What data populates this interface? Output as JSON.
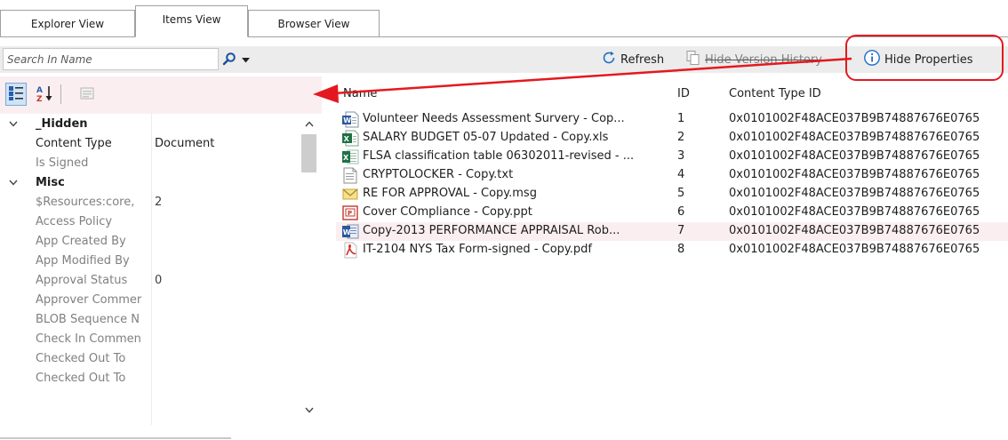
{
  "tabs": [
    {
      "label": "Explorer View",
      "active": false
    },
    {
      "label": "Items View",
      "active": true
    },
    {
      "label": "Browser View",
      "active": false
    }
  ],
  "toolbar": {
    "search_placeholder": "Search In Name",
    "refresh_label": "Refresh",
    "hide_version_history_label": "Hide Version History",
    "hide_properties_label": "Hide Properties"
  },
  "properties": {
    "rows": [
      {
        "type": "category",
        "name": "_Hidden",
        "expanded": true
      },
      {
        "type": "item",
        "name": "Content Type",
        "value": "Document",
        "emphasis": true
      },
      {
        "type": "item",
        "name": "Is Signed",
        "value": ""
      },
      {
        "type": "category",
        "name": "Misc",
        "expanded": true
      },
      {
        "type": "item",
        "name": "$Resources:core,",
        "value": "2"
      },
      {
        "type": "item",
        "name": "Access Policy",
        "value": ""
      },
      {
        "type": "item",
        "name": "App Created By",
        "value": ""
      },
      {
        "type": "item",
        "name": "App Modified By",
        "value": ""
      },
      {
        "type": "item",
        "name": "Approval Status",
        "value": "0"
      },
      {
        "type": "item",
        "name": "Approver Commer",
        "value": ""
      },
      {
        "type": "item",
        "name": "BLOB Sequence N",
        "value": ""
      },
      {
        "type": "item",
        "name": "Check In Commen",
        "value": ""
      },
      {
        "type": "item",
        "name": "Checked Out To",
        "value": ""
      },
      {
        "type": "item",
        "name": "Checked Out To",
        "value": ""
      }
    ]
  },
  "list": {
    "columns": {
      "name": "Name",
      "id": "ID",
      "content_type_id": "Content Type ID"
    },
    "rows": [
      {
        "icon": "word-doc-icon",
        "name": "Volunteer Needs Assessment Survery - Cop...",
        "id": "1",
        "content_type_id": "0x0101002F48ACE037B9B74887676E0765",
        "selected": false
      },
      {
        "icon": "excel-icon",
        "name": "SALARY BUDGET 05-07 Updated - Copy.xls",
        "id": "2",
        "content_type_id": "0x0101002F48ACE037B9B74887676E0765",
        "selected": false
      },
      {
        "icon": "excel-icon",
        "name": "FLSA classification table 06302011-revised - ...",
        "id": "3",
        "content_type_id": "0x0101002F48ACE037B9B74887676E0765",
        "selected": false
      },
      {
        "icon": "text-file-icon",
        "name": "CRYPTOLOCKER - Copy.txt",
        "id": "4",
        "content_type_id": "0x0101002F48ACE037B9B74887676E0765",
        "selected": false
      },
      {
        "icon": "email-icon",
        "name": "RE  FOR APPROVAL  - Copy.msg",
        "id": "5",
        "content_type_id": "0x0101002F48ACE037B9B74887676E0765",
        "selected": false
      },
      {
        "icon": "powerpoint-icon",
        "name": "Cover COmpliance - Copy.ppt",
        "id": "6",
        "content_type_id": "0x0101002F48ACE037B9B74887676E0765",
        "selected": false
      },
      {
        "icon": "word-docx-icon",
        "name": "Copy-2013 PERFORMANCE APPRAISAL Rob...",
        "id": "7",
        "content_type_id": "0x0101002F48ACE037B9B74887676E0765",
        "selected": true
      },
      {
        "icon": "pdf-icon",
        "name": "IT-2104 NYS Tax Form-signed - Copy.pdf",
        "id": "8",
        "content_type_id": "0x0101002F48ACE037B9B74887676E0765",
        "selected": false
      }
    ]
  },
  "colors": {
    "annotation_red": "#e3191f",
    "selected_row": "#fbeef0",
    "toolbar_bg": "#ececec"
  }
}
